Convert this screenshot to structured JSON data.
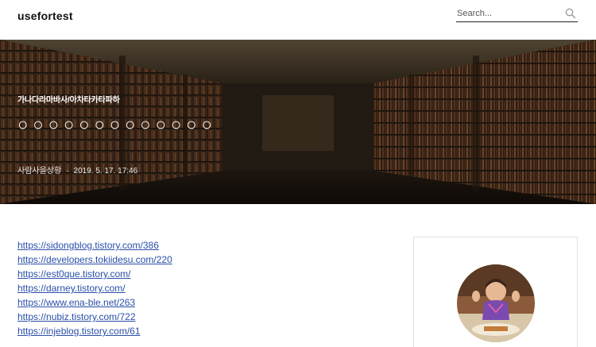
{
  "header": {
    "blog_title": "usefortest",
    "search_placeholder": "Search..."
  },
  "post": {
    "category": "가나다라마바사/아차타카타파하",
    "title": "○○○○○○○○○○○○○",
    "author": "사람사을상황",
    "date": "2019. 5. 17. 17:46"
  },
  "links": [
    "https://sidongblog.tistory.com/386",
    "https://developers.tokiidesu.com/220",
    "https://est0que.tistory.com/",
    "https://darney.tistory.com/",
    "https://www.ena-ble.net/263",
    "https://nubiz.tistory.com/722",
    "https://injeblog.tistory.com/61"
  ],
  "icons": {
    "search": "search-icon"
  }
}
